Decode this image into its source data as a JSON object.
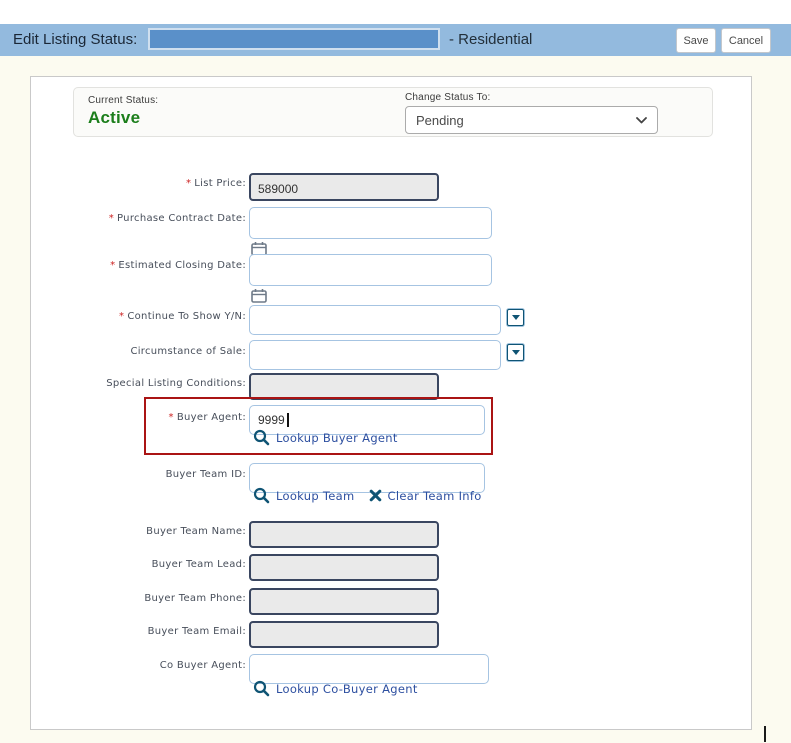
{
  "header": {
    "title": "Edit Listing Status:",
    "suffix": "- Residential",
    "save_label": "Save",
    "cancel_label": "Cancel"
  },
  "status": {
    "current_label": "Current Status:",
    "current_value": "Active",
    "change_label": "Change Status To:",
    "change_value": "Pending"
  },
  "form": {
    "required_marker": "*",
    "list_price": {
      "label": "List Price:",
      "value": "589000"
    },
    "purchase_contract_date": {
      "label": "Purchase Contract Date:",
      "value": ""
    },
    "estimated_closing_date": {
      "label": "Estimated Closing Date:",
      "value": ""
    },
    "continue_to_show": {
      "label": "Continue To Show Y/N:",
      "value": ""
    },
    "circumstance_of_sale": {
      "label": "Circumstance of Sale:",
      "value": ""
    },
    "special_listing_conditions": {
      "label": "Special Listing Conditions:",
      "value": ""
    },
    "buyer_agent": {
      "label": "Buyer Agent:",
      "value": "9999",
      "lookup_label": "Lookup Buyer Agent"
    },
    "buyer_team_id": {
      "label": "Buyer Team ID:",
      "value": "",
      "lookup_label": "Lookup Team",
      "clear_label": "Clear Team Info"
    },
    "buyer_team_name": {
      "label": "Buyer Team Name:",
      "value": ""
    },
    "buyer_team_lead": {
      "label": "Buyer Team Lead:",
      "value": ""
    },
    "buyer_team_phone": {
      "label": "Buyer Team Phone:",
      "value": ""
    },
    "buyer_team_email": {
      "label": "Buyer Team Email:",
      "value": ""
    },
    "co_buyer_agent": {
      "label": "Co Buyer Agent:",
      "value": "",
      "lookup_label": "Lookup Co-Buyer Agent"
    }
  },
  "icons": {
    "lookup": "magnifier",
    "clear": "x-mark",
    "dropdown": "down-triangle",
    "date_picker": "calendar",
    "select_chevron": "chevron-down"
  },
  "colors": {
    "header_bg": "#93bade",
    "redacted_fill": "#5a90c9",
    "status_green": "#1b7e1b",
    "annotation_red": "#aa1414",
    "link_blue": "#2d4fa0",
    "icon_teal": "#0f5474",
    "readonly_bg": "#eaeaea",
    "readonly_border": "#3a4660",
    "input_border": "#a6c4e2"
  }
}
